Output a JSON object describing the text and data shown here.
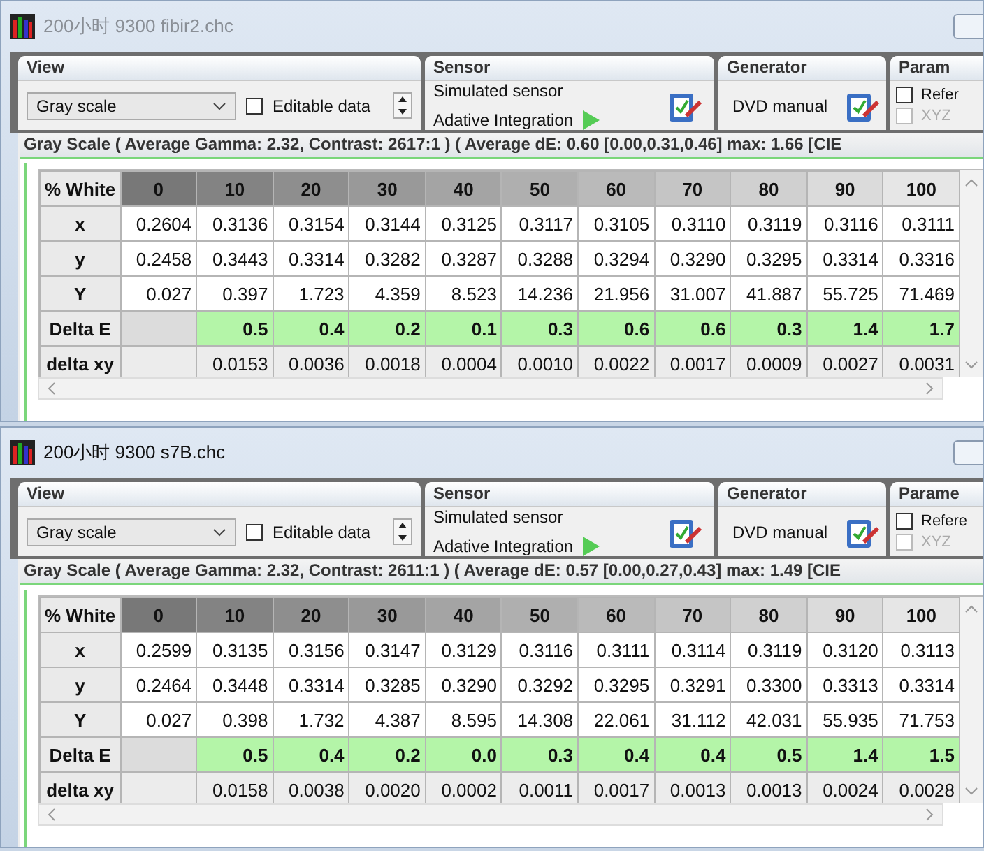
{
  "windows": [
    {
      "title": "200小时 9300 fibir2.chc",
      "active": false,
      "view": {
        "title": "View",
        "mode": "Gray scale",
        "editable_label": "Editable data",
        "editable": false
      },
      "sensor": {
        "title": "Sensor",
        "name": "Simulated sensor",
        "mode": "Adative Integration"
      },
      "generator": {
        "title": "Generator",
        "name": "DVD manual"
      },
      "params": {
        "title": "Param",
        "reference_label": "Refer",
        "reference": false,
        "xyz_label": "XYZ",
        "xyz_disabled": true
      },
      "summary": "Gray Scale ( Average Gamma: 2.32, Contrast: 2617:1 ) ( Average dE: 0.60 [0.00,0.31,0.46] max: 1.66 [CIE",
      "table": {
        "corner": "% White",
        "columns": [
          "0",
          "10",
          "20",
          "30",
          "40",
          "50",
          "60",
          "70",
          "80",
          "90",
          "100"
        ],
        "rows": [
          {
            "label": "x",
            "kind": "value",
            "cells": [
              "0.2604",
              "0.3136",
              "0.3154",
              "0.3144",
              "0.3125",
              "0.3117",
              "0.3105",
              "0.3110",
              "0.3119",
              "0.3116",
              "0.3111"
            ]
          },
          {
            "label": "y",
            "kind": "value",
            "cells": [
              "0.2458",
              "0.3443",
              "0.3314",
              "0.3282",
              "0.3287",
              "0.3288",
              "0.3294",
              "0.3290",
              "0.3295",
              "0.3314",
              "0.3316"
            ]
          },
          {
            "label": "Y",
            "kind": "value",
            "cells": [
              "0.027",
              "0.397",
              "1.723",
              "4.359",
              "8.523",
              "14.236",
              "21.956",
              "31.007",
              "41.887",
              "55.725",
              "71.469"
            ]
          },
          {
            "label": "Delta E",
            "kind": "delta_e",
            "cells": [
              "0.5",
              "0.4",
              "0.2",
              "0.1",
              "0.3",
              "0.6",
              "0.6",
              "0.3",
              "1.4",
              "1.7"
            ]
          },
          {
            "label": "delta xy",
            "kind": "delta",
            "cells": [
              "0.0153",
              "0.0036",
              "0.0018",
              "0.0004",
              "0.0010",
              "0.0022",
              "0.0017",
              "0.0009",
              "0.0027",
              "0.0031"
            ]
          }
        ]
      }
    },
    {
      "title": "200小时 9300 s7B.chc",
      "active": true,
      "view": {
        "title": "View",
        "mode": "Gray scale",
        "editable_label": "Editable data",
        "editable": false
      },
      "sensor": {
        "title": "Sensor",
        "name": "Simulated sensor",
        "mode": "Adative Integration"
      },
      "generator": {
        "title": "Generator",
        "name": "DVD manual"
      },
      "params": {
        "title": "Parame",
        "reference_label": "Refere",
        "reference": false,
        "xyz_label": "XYZ",
        "xyz_disabled": true
      },
      "summary": "Gray Scale ( Average Gamma: 2.32, Contrast: 2611:1 ) ( Average dE: 0.57 [0.00,0.27,0.43] max: 1.49 [CIE",
      "table": {
        "corner": "% White",
        "columns": [
          "0",
          "10",
          "20",
          "30",
          "40",
          "50",
          "60",
          "70",
          "80",
          "90",
          "100"
        ],
        "rows": [
          {
            "label": "x",
            "kind": "value",
            "cells": [
              "0.2599",
              "0.3135",
              "0.3156",
              "0.3147",
              "0.3129",
              "0.3116",
              "0.3111",
              "0.3114",
              "0.3119",
              "0.3120",
              "0.3113"
            ]
          },
          {
            "label": "y",
            "kind": "value",
            "cells": [
              "0.2464",
              "0.3448",
              "0.3314",
              "0.3285",
              "0.3290",
              "0.3292",
              "0.3295",
              "0.3291",
              "0.3300",
              "0.3313",
              "0.3314"
            ]
          },
          {
            "label": "Y",
            "kind": "value",
            "cells": [
              "0.027",
              "0.398",
              "1.732",
              "4.387",
              "8.595",
              "14.308",
              "22.061",
              "31.112",
              "42.031",
              "55.935",
              "71.753"
            ]
          },
          {
            "label": "Delta E",
            "kind": "delta_e",
            "cells": [
              "0.5",
              "0.4",
              "0.2",
              "0.0",
              "0.3",
              "0.4",
              "0.4",
              "0.5",
              "1.4",
              "1.5"
            ]
          },
          {
            "label": "delta xy",
            "kind": "delta",
            "cells": [
              "0.0158",
              "0.0038",
              "0.0020",
              "0.0002",
              "0.0011",
              "0.0017",
              "0.0013",
              "0.0013",
              "0.0024",
              "0.0028"
            ]
          }
        ]
      }
    }
  ]
}
